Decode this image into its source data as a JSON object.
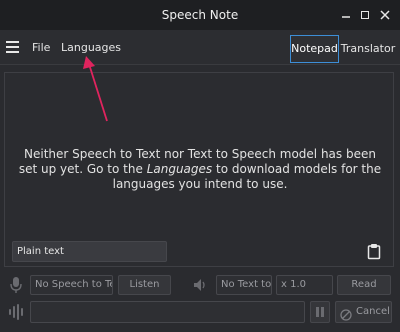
{
  "window": {
    "title": "Speech Note"
  },
  "menu": {
    "file": "File",
    "languages": "Languages"
  },
  "tabs": [
    {
      "label": "Notepad",
      "active": true
    },
    {
      "label": "Translator",
      "active": false
    }
  ],
  "editor": {
    "message_part1": "Neither Speech to Text nor Text to Speech model has been set up yet. Go to the ",
    "message_link": "Languages",
    "message_part2": " to download models for the languages you intend to use.",
    "format_value": "Plain text"
  },
  "controls": {
    "stt_placeholder": "No Speech to Text model",
    "listen_label": "Listen",
    "tts_placeholder": "No Text to Speech model",
    "speed_value": "x 1.0",
    "read_label": "Read",
    "cancel_label": "Cancel"
  },
  "colors": {
    "accent": "#3d8ed7",
    "annotation_arrow": "#e0245e"
  },
  "icons": [
    "hamburger-icon",
    "minimize-icon",
    "maximize-icon",
    "close-icon",
    "clipboard-icon",
    "microphone-icon",
    "speaker-icon",
    "waveform-icon",
    "pause-icon",
    "cancel-icon"
  ]
}
